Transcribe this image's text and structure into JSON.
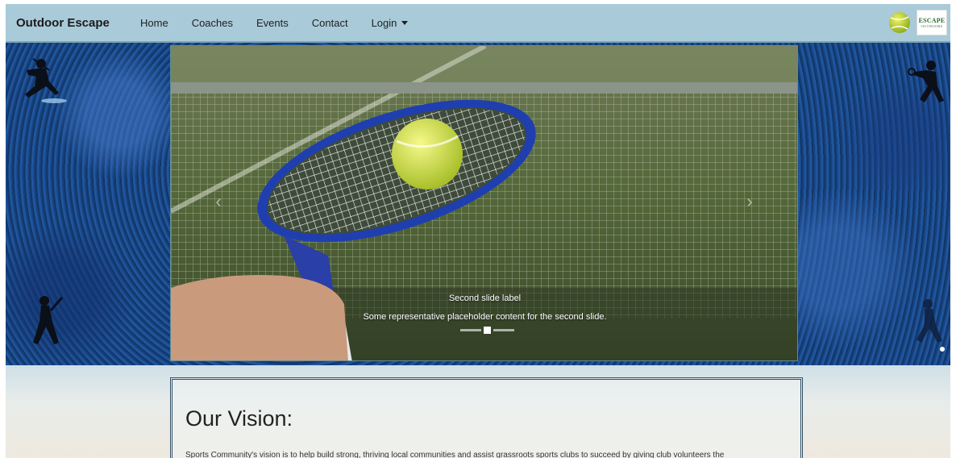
{
  "navbar": {
    "brand": "Outdoor Escape",
    "links": [
      "Home",
      "Coaches",
      "Events",
      "Contact"
    ],
    "login_label": "Login",
    "logo_main": "ESCAPE",
    "logo_sub": "OUTDOORS"
  },
  "carousel": {
    "prev_icon": "‹",
    "next_icon": "›",
    "slide_title": "Second slide label",
    "slide_text": "Some representative placeholder content for the second slide.",
    "slide_count": 3,
    "active_slide_index": 1
  },
  "vision": {
    "title": "Our Vision:",
    "text": "Sports Community's vision is to help build strong, thriving local communities and assist grassroots sports clubs to succeed by giving club volunteers the"
  },
  "colors": {
    "navbar_bg": "#a9cad9",
    "hero_bg": "#184a8c",
    "racket_blue": "#1f3fb0",
    "ball": "#d8e04a"
  }
}
